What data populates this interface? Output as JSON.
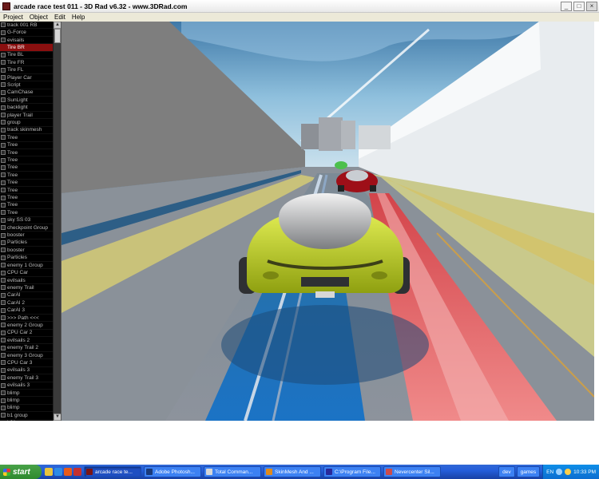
{
  "window": {
    "title": "arcade race test 011 - 3D Rad v6.32 - www.3DRad.com",
    "minimize": "_",
    "maximize": "□",
    "close": "×"
  },
  "menu": [
    "Project",
    "Object",
    "Edit",
    "Help"
  ],
  "objects": [
    "track 001 RB",
    "G-Force",
    "evisails",
    "Tire BR",
    "Tire BL",
    "Tire FR",
    "Tire FL",
    "Player Car",
    "Script",
    "CamChase",
    "SunLight",
    "backlight",
    "player Trail",
    "group",
    "track skinmesh",
    "Tree",
    "Tree",
    "Tree",
    "Tree",
    "Tree",
    "Tree",
    "Tree",
    "Tree",
    "Tree",
    "Tree",
    "Tree",
    "sky SS 03",
    "checkpoint Group",
    "booster",
    "Particles",
    "booster",
    "Particles",
    "enemy 1 Group",
    "CPU Car",
    "evilsails",
    "enemy Trail",
    "CarAI",
    "CarAI 2",
    "CarAI 3",
    ">>> Path <<<",
    "enemy 2 Group",
    "CPU Car 2",
    "evilsails 2",
    "enemy Trail 2",
    "enemy 3 Group",
    "CPU Car 3",
    "evilsails 3",
    "enemy Trail 3",
    "evilsails 3",
    "blimp",
    "blimp",
    "blimp",
    "b1 group",
    "b01"
  ],
  "selected_object": "Tire BR",
  "taskbar": {
    "start": "start",
    "tasks": [
      {
        "label": "arcade race te...",
        "active": true
      },
      {
        "label": "Adobe Photosh...",
        "active": false
      },
      {
        "label": "Total Comman...",
        "active": false
      },
      {
        "label": "SkinMesh And ...",
        "active": false
      },
      {
        "label": "C:\\Program File...",
        "active": false
      },
      {
        "label": "Nevercenter Sil...",
        "active": false
      }
    ],
    "folders": [
      "dev",
      "games"
    ],
    "language": "EN",
    "clock": "10:33 PM"
  },
  "colors": {
    "selection": "#8a0f0f",
    "taskbar": "#245edb",
    "start": "#3c9a3c",
    "player_car": "#c6d82a",
    "enemy_car": "#b0121c"
  }
}
